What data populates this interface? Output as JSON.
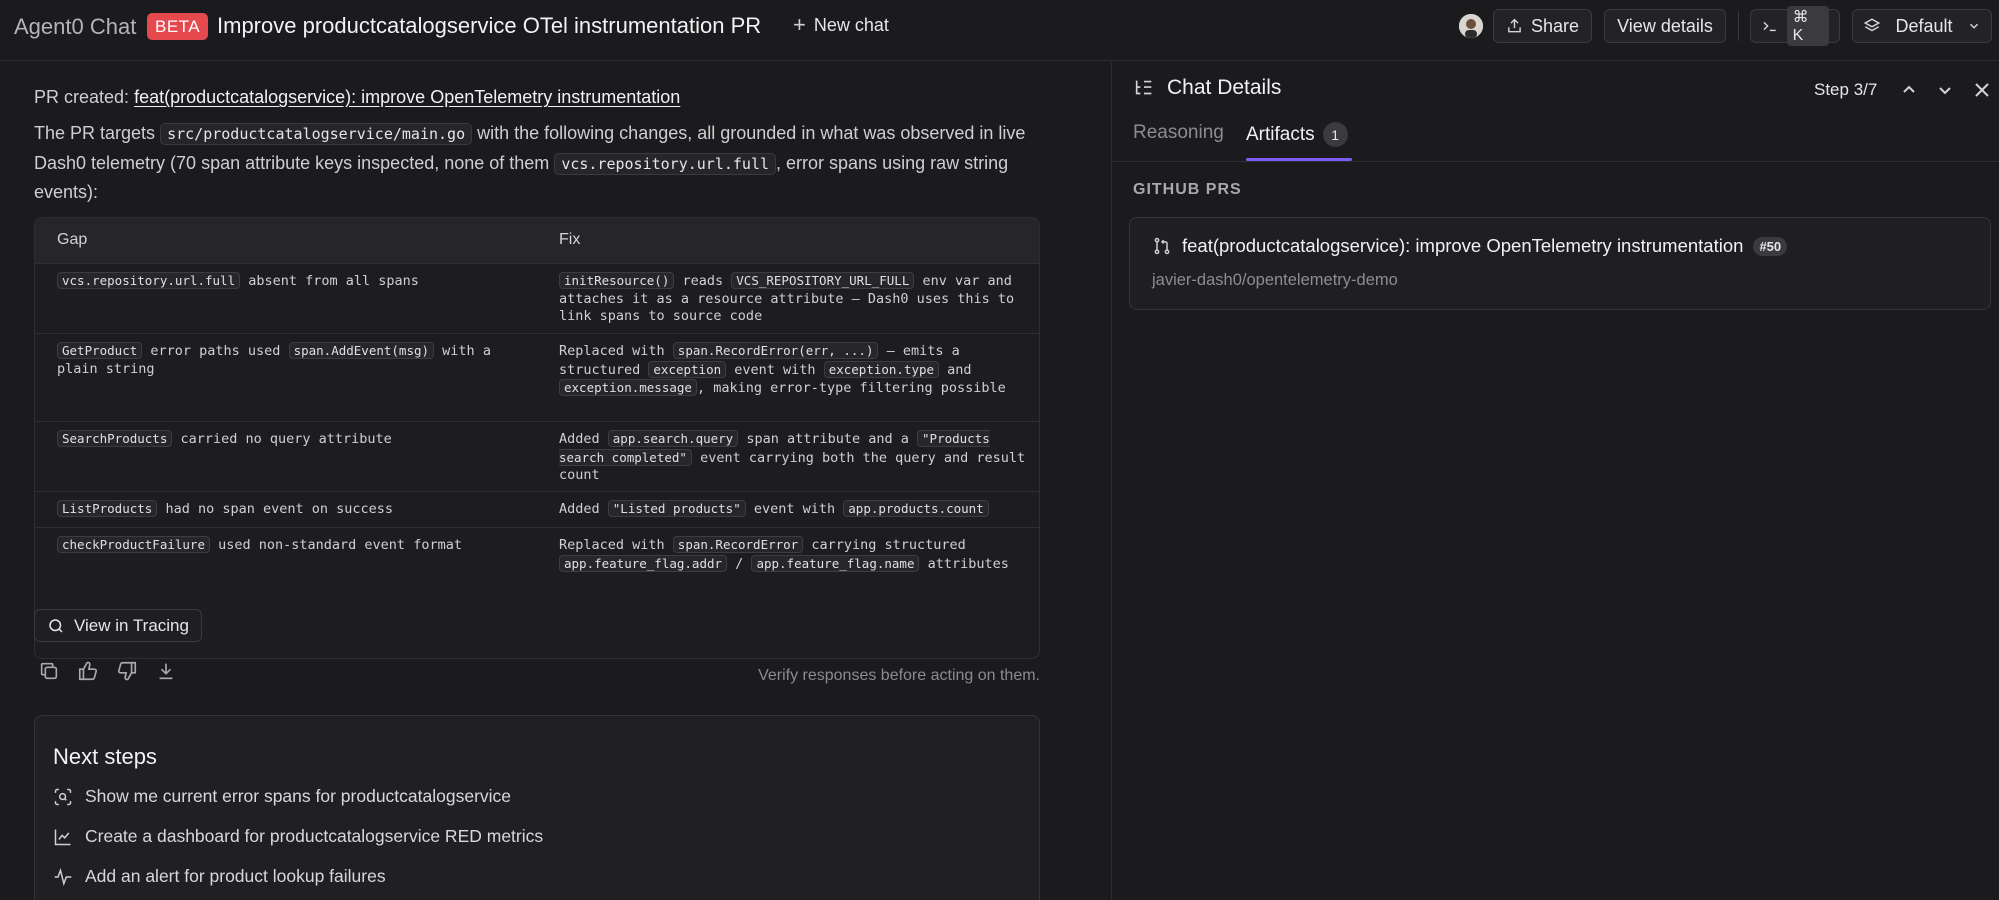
{
  "header": {
    "app_name": "Agent0 Chat",
    "beta_badge": "BETA",
    "chat_title": "Improve productcatalogservice OTel instrumentation PR",
    "new_chat_label": "New chat",
    "share_label": "Share",
    "view_details_label": "View details",
    "shortcut_label": "⌘ K",
    "model_label": "Default"
  },
  "message": {
    "pr_created_prefix": "PR created:",
    "pr_link_text": "feat(productcatalogservice): improve OpenTelemetry instrumentation",
    "para_part1": "The PR targets",
    "para_code1": "src/productcatalogservice/main.go",
    "para_part2": "with the following changes, all grounded in what was observed in live Dash0 telemetry (70 span attribute keys inspected, none of them",
    "para_code2": "vcs.repository.url.full",
    "para_part3": ", error spans using raw string events):",
    "table": {
      "headers": [
        "Gap",
        "Fix"
      ],
      "rows": [
        {
          "gap_code": "vcs.repository.url.full",
          "gap_text": " absent from all spans",
          "fix_code1": "initResource()",
          "fix_t1": " reads ",
          "fix_code2": "VCS_REPOSITORY_URL_FULL",
          "fix_t2": " env var and attaches it as a resource attribute — Dash0 uses this to link spans to source code"
        },
        {
          "gap_code": "GetProduct",
          "gap_text1": " error paths used ",
          "gap_code2": "span.AddEvent(msg)",
          "gap_text2": " with a plain string",
          "fix_t0": "Replaced with ",
          "fix_code1": "span.RecordError(err, ...)",
          "fix_t1": " — emits a structured ",
          "fix_code2": "exception",
          "fix_t2": " event with ",
          "fix_code3": "exception.type",
          "fix_t3": " and ",
          "fix_code4": "exception.message",
          "fix_t4": ", making error-type filtering possible"
        },
        {
          "gap_code": "SearchProducts",
          "gap_text": " carried no query attribute",
          "fix_t0": "Added ",
          "fix_code1": "app.search.query",
          "fix_t1": " span attribute and a ",
          "fix_code2": "\"Products search completed\"",
          "fix_t2": " event carrying both the query and result count"
        },
        {
          "gap_code": "ListProducts",
          "gap_text": " had no span event on success",
          "fix_t0": "Added ",
          "fix_code1": "\"Listed products\"",
          "fix_t1": " event with ",
          "fix_code2": "app.products.count"
        },
        {
          "gap_code": "checkProductFailure",
          "gap_text": " used non-standard event format",
          "fix_t0": "Replaced with ",
          "fix_code1": "span.RecordError",
          "fix_t1": " carrying structured ",
          "fix_code2": "app.feature_flag.addr",
          "fix_t2": " / ",
          "fix_code3": "app.feature_flag.name",
          "fix_t3": " attributes"
        }
      ]
    },
    "view_in_tracing_label": "View in Tracing",
    "verify_note": "Verify responses before acting on them."
  },
  "next_steps": {
    "title": "Next steps",
    "items": [
      {
        "label": "Show me current error spans for productcatalogservice",
        "icon": "scan-search-icon"
      },
      {
        "label": "Create a dashboard for productcatalogservice RED metrics",
        "icon": "line-chart-icon"
      },
      {
        "label": "Add an alert for product lookup failures",
        "icon": "activity-icon"
      }
    ]
  },
  "panel": {
    "title": "Chat Details",
    "step": "Step 3/7",
    "tabs": {
      "reasoning": "Reasoning",
      "artifacts": "Artifacts",
      "artifacts_count": "1"
    },
    "section_label": "GITHUB PRS",
    "pr": {
      "title": "feat(productcatalogservice): improve OpenTelemetry instrumentation",
      "number": "#50",
      "repo": "javier-dash0/opentelemetry-demo"
    }
  },
  "colors": {
    "background": "#1b1b1d",
    "beta_badge": "#e5484d",
    "tab_accent": "#7c5cf4"
  }
}
